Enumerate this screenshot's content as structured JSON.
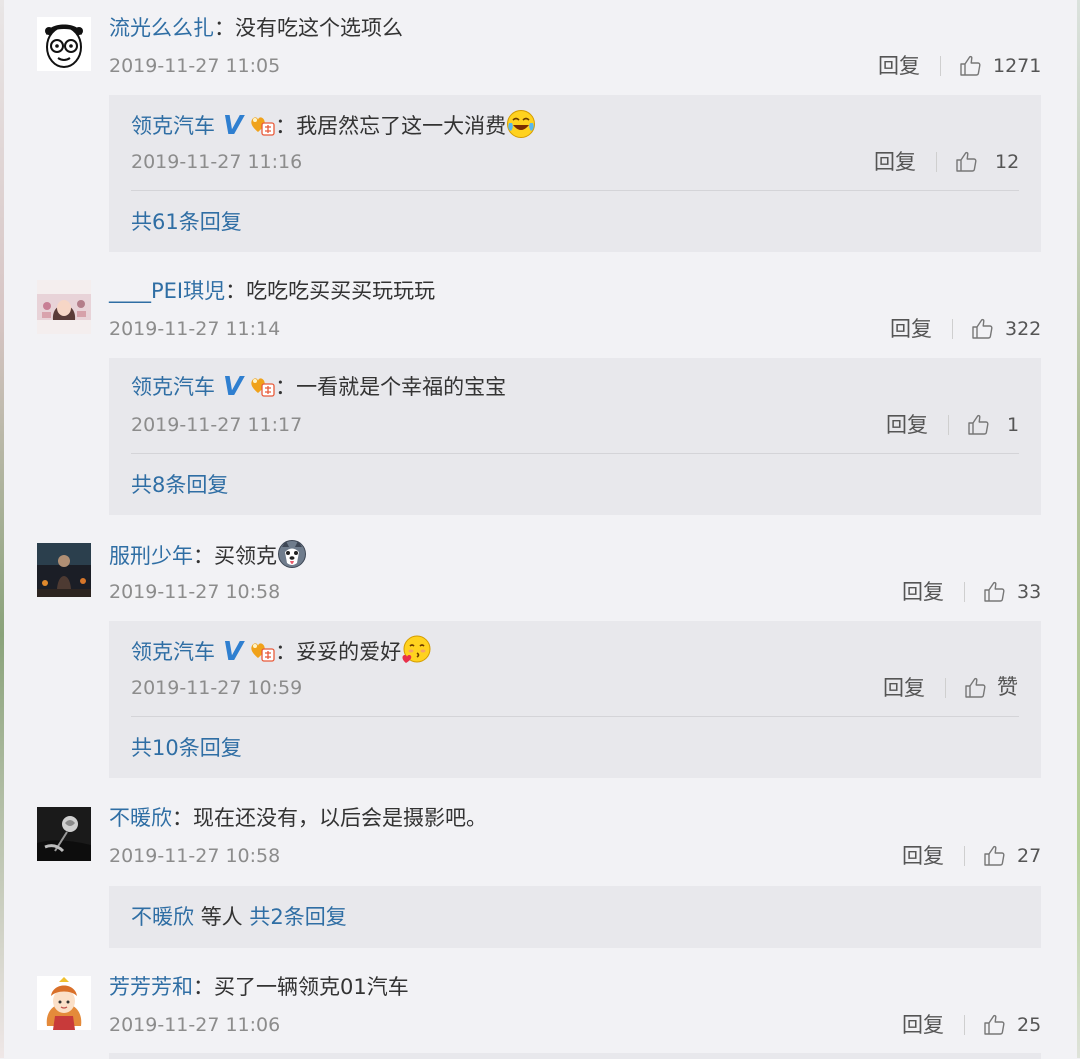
{
  "colors": {
    "link": "#2f6ea4",
    "text": "#333333",
    "meta": "#8c8c8c",
    "page_bg": "#f2f2f5",
    "reply_bg": "#e8e8ec",
    "verified": "#2f7fd0"
  },
  "reply_label": "回复",
  "comments": [
    {
      "name": "流光么么扎",
      "text": "没有吃这个选项么",
      "time": "2019-11-27 11:05",
      "likes": "1271",
      "avatar": "cartoon-face-avatar",
      "reply": {
        "name": "领克汽车",
        "text": "我居然忘了这一大消费",
        "emoji": "laugh-cry-emoji",
        "time": "2019-11-27 11:16",
        "likes": "12"
      },
      "more": "共61条回复"
    },
    {
      "name": "____PEI琪児",
      "text": "吃吃吃买买买玩玩玩",
      "time": "2019-11-27 11:14",
      "likes": "322",
      "avatar": "girl-photo-avatar",
      "reply": {
        "name": "领克汽车",
        "text": "一看就是个幸福的宝宝",
        "time": "2019-11-27 11:17",
        "likes": "1"
      },
      "more": "共8条回复"
    },
    {
      "name": "服刑少年",
      "text": "买领克",
      "emoji": "husky-emoji",
      "time": "2019-11-27 10:58",
      "likes": "33",
      "avatar": "dark-photo-avatar",
      "reply": {
        "name": "领克汽车",
        "text": "妥妥的爱好",
        "emoji": "heart-kiss-emoji",
        "time": "2019-11-27 10:59",
        "likes": "赞"
      },
      "more": "共10条回复"
    },
    {
      "name": "不暖欣",
      "text": "现在还没有，以后会是摄影吧。",
      "time": "2019-11-27 10:58",
      "likes": "27",
      "avatar": "rose-photo-avatar",
      "more_name": "不暖欣",
      "more_mid": "等人",
      "more": "共2条回复"
    },
    {
      "name": "芳芳芳和",
      "text": "买了一辆领克01汽车",
      "time": "2019-11-27 11:06",
      "likes": "25",
      "avatar": "cartoon-girl-avatar"
    }
  ]
}
